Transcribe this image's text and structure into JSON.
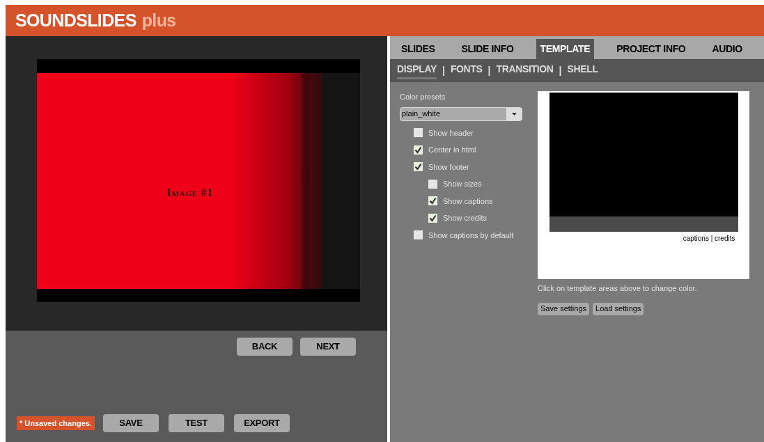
{
  "header": {
    "title": "SOUNDSLIDES",
    "subtitle": "plus"
  },
  "preview": {
    "slide_text": "Image #1"
  },
  "nav_buttons": [
    "BACK",
    "NEXT"
  ],
  "status": {
    "unsaved": "* Unsaved changes."
  },
  "action_buttons": [
    "SAVE",
    "TEST",
    "EXPORT"
  ],
  "tabs": [
    {
      "label": "SLIDES",
      "selected": false
    },
    {
      "label": "SLIDE INFO",
      "selected": false
    },
    {
      "label": "TEMPLATE",
      "selected": true
    },
    {
      "label": "PROJECT INFO",
      "selected": false
    },
    {
      "label": "AUDIO",
      "selected": false
    }
  ],
  "subtabs": [
    {
      "label": "DISPLAY",
      "selected": true
    },
    {
      "label": "FONTS",
      "selected": false
    },
    {
      "label": "TRANSITION",
      "selected": false
    },
    {
      "label": "SHELL",
      "selected": false
    }
  ],
  "subtab_separator": "|",
  "color_presets": {
    "label": "Color presets",
    "value": "plain_white"
  },
  "options": [
    {
      "label": "Show header",
      "checked": false
    },
    {
      "label": "Center in html",
      "checked": true
    },
    {
      "label": "Show footer",
      "checked": true,
      "children": [
        {
          "label": "Show sizes",
          "checked": false
        },
        {
          "label": "Show captions",
          "checked": true
        },
        {
          "label": "Show credits",
          "checked": true
        }
      ]
    },
    {
      "label": "Show captions by default",
      "checked": false
    }
  ],
  "template_preview": {
    "footer_links": "captions | credits"
  },
  "hint": "Click on template areas above to change color.",
  "settings_buttons": [
    "Save settings",
    "Load settings"
  ]
}
